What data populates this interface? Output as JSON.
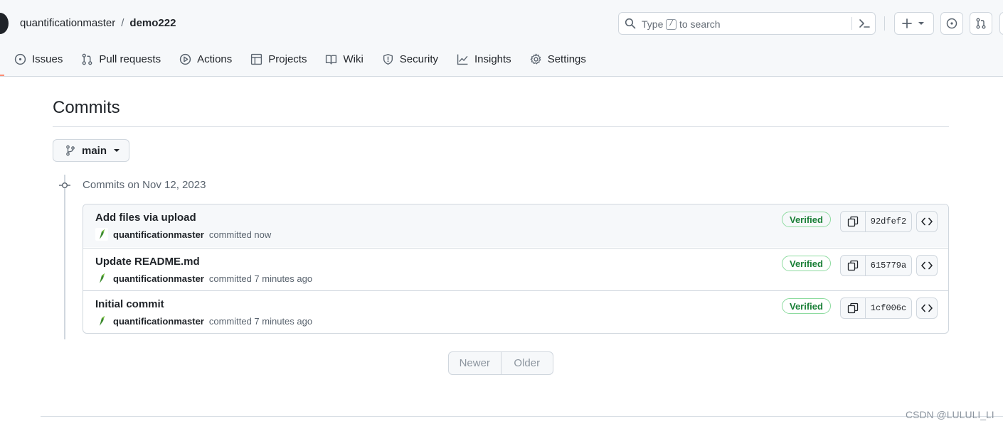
{
  "header": {
    "owner": "quantificationmaster",
    "separator": "/",
    "repo": "demo222",
    "search": {
      "prefix": "Type",
      "key": "/",
      "suffix": "to search"
    }
  },
  "nav": {
    "tabs": [
      {
        "label": "Issues",
        "icon": "issue-opened-icon"
      },
      {
        "label": "Pull requests",
        "icon": "git-pull-request-icon"
      },
      {
        "label": "Actions",
        "icon": "play-icon"
      },
      {
        "label": "Projects",
        "icon": "table-icon"
      },
      {
        "label": "Wiki",
        "icon": "book-icon"
      },
      {
        "label": "Security",
        "icon": "shield-icon"
      },
      {
        "label": "Insights",
        "icon": "graph-icon"
      },
      {
        "label": "Settings",
        "icon": "gear-icon"
      }
    ]
  },
  "page": {
    "title": "Commits",
    "branch": "main",
    "day_label": "Commits on Nov 12, 2023"
  },
  "commits": [
    {
      "message": "Add files via upload",
      "author": "quantificationmaster",
      "time": "committed now",
      "badge": "Verified",
      "sha": "92dfef2"
    },
    {
      "message": "Update README.md",
      "author": "quantificationmaster",
      "time": "committed 7 minutes ago",
      "badge": "Verified",
      "sha": "615779a"
    },
    {
      "message": "Initial commit",
      "author": "quantificationmaster",
      "time": "committed 7 minutes ago",
      "badge": "Verified",
      "sha": "1cf006c"
    }
  ],
  "pagination": {
    "newer": "Newer",
    "older": "Older"
  },
  "watermark": "CSDN @LULULI_LI",
  "colors": {
    "verified": "#1a7f37",
    "border": "#d0d7de",
    "tab_underline": "#fd8c73"
  }
}
